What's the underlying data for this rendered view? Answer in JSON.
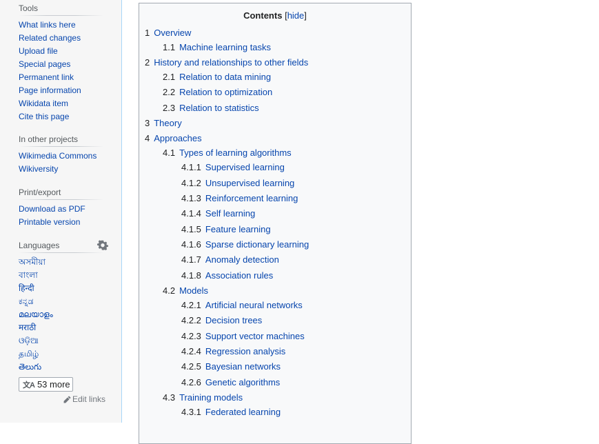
{
  "sidebar": {
    "tools": {
      "heading": "Tools",
      "items": [
        "What links here",
        "Related changes",
        "Upload file",
        "Special pages",
        "Permanent link",
        "Page information",
        "Wikidata item",
        "Cite this page"
      ]
    },
    "other_projects": {
      "heading": "In other projects",
      "items": [
        "Wikimedia Commons",
        "Wikiversity"
      ]
    },
    "print_export": {
      "heading": "Print/export",
      "items": [
        "Download as PDF",
        "Printable version"
      ]
    },
    "languages": {
      "heading": "Languages",
      "settings_icon": "gear-icon",
      "items": [
        "অসমীয়া",
        "বাংলা",
        "हिन्दी",
        "ಕನ್ನಡ",
        "മലയാളം",
        "मराठी",
        "ଓଡ଼ିଆ",
        "தமிழ்",
        "తెలుగు"
      ],
      "more_button": "53 more",
      "more_icon": "translate-icon",
      "edit_links": "Edit links",
      "edit_icon": "pencil-icon"
    }
  },
  "toc": {
    "title": "Contents",
    "hide_label": "hide",
    "items": [
      {
        "num": "1",
        "label": "Overview",
        "level": 1
      },
      {
        "num": "1.1",
        "label": "Machine learning tasks",
        "level": 2
      },
      {
        "num": "2",
        "label": "History and relationships to other fields",
        "level": 1
      },
      {
        "num": "2.1",
        "label": "Relation to data mining",
        "level": 2
      },
      {
        "num": "2.2",
        "label": "Relation to optimization",
        "level": 2
      },
      {
        "num": "2.3",
        "label": "Relation to statistics",
        "level": 2
      },
      {
        "num": "3",
        "label": "Theory",
        "level": 1
      },
      {
        "num": "4",
        "label": "Approaches",
        "level": 1
      },
      {
        "num": "4.1",
        "label": "Types of learning algorithms",
        "level": 2
      },
      {
        "num": "4.1.1",
        "label": "Supervised learning",
        "level": 3
      },
      {
        "num": "4.1.2",
        "label": "Unsupervised learning",
        "level": 3
      },
      {
        "num": "4.1.3",
        "label": "Reinforcement learning",
        "level": 3
      },
      {
        "num": "4.1.4",
        "label": "Self learning",
        "level": 3
      },
      {
        "num": "4.1.5",
        "label": "Feature learning",
        "level": 3
      },
      {
        "num": "4.1.6",
        "label": "Sparse dictionary learning",
        "level": 3
      },
      {
        "num": "4.1.7",
        "label": "Anomaly detection",
        "level": 3
      },
      {
        "num": "4.1.8",
        "label": "Association rules",
        "level": 3
      },
      {
        "num": "4.2",
        "label": "Models",
        "level": 2
      },
      {
        "num": "4.2.1",
        "label": "Artificial neural networks",
        "level": 3
      },
      {
        "num": "4.2.2",
        "label": "Decision trees",
        "level": 3
      },
      {
        "num": "4.2.3",
        "label": "Support vector machines",
        "level": 3
      },
      {
        "num": "4.2.4",
        "label": "Regression analysis",
        "level": 3
      },
      {
        "num": "4.2.5",
        "label": "Bayesian networks",
        "level": 3
      },
      {
        "num": "4.2.6",
        "label": "Genetic algorithms",
        "level": 3
      },
      {
        "num": "4.3",
        "label": "Training models",
        "level": 2
      },
      {
        "num": "4.3.1",
        "label": "Federated learning",
        "level": 3
      }
    ]
  }
}
